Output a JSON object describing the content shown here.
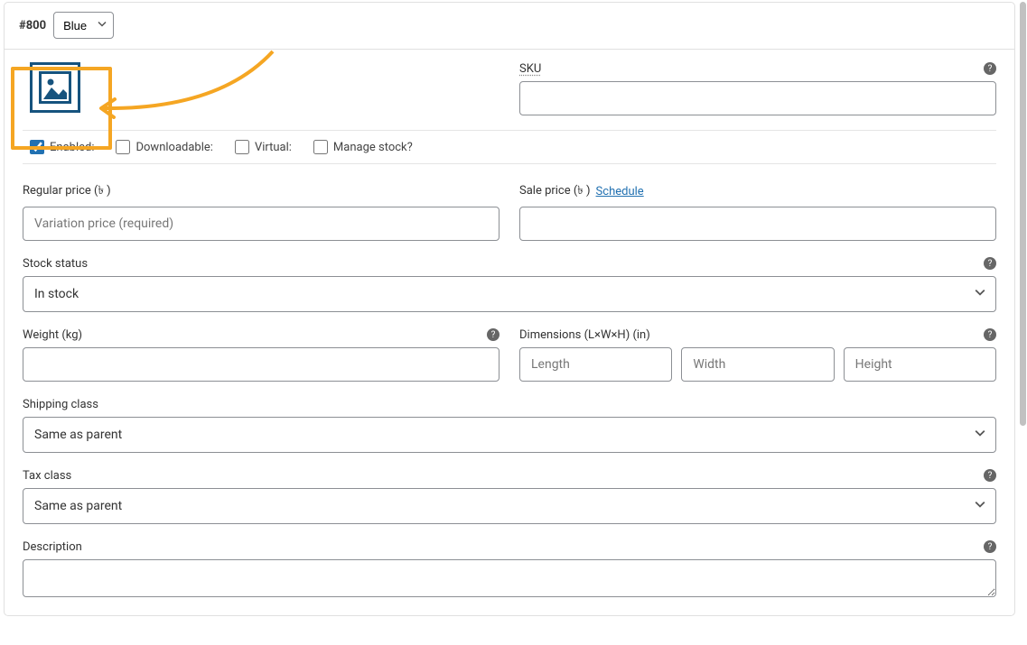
{
  "header": {
    "variation_number": "#800",
    "attribute_value": "Blue"
  },
  "sku": {
    "label": "SKU",
    "value": ""
  },
  "checkboxes": {
    "enabled": {
      "label": "Enabled:",
      "checked": true
    },
    "downloadable": {
      "label": "Downloadable:",
      "checked": false
    },
    "virtual": {
      "label": "Virtual:",
      "checked": false
    },
    "manage_stock": {
      "label": "Manage stock?",
      "checked": false
    }
  },
  "regular_price": {
    "label": "Regular price (৳ )",
    "placeholder": "Variation price (required)",
    "value": ""
  },
  "sale_price": {
    "label": "Sale price (৳ )",
    "schedule_link": "Schedule",
    "value": ""
  },
  "stock_status": {
    "label": "Stock status",
    "value": "In stock"
  },
  "weight": {
    "label": "Weight (kg)",
    "value": ""
  },
  "dimensions": {
    "label": "Dimensions (L×W×H) (in)",
    "length_placeholder": "Length",
    "width_placeholder": "Width",
    "height_placeholder": "Height"
  },
  "shipping_class": {
    "label": "Shipping class",
    "value": "Same as parent"
  },
  "tax_class": {
    "label": "Tax class",
    "value": "Same as parent"
  },
  "description": {
    "label": "Description",
    "value": ""
  },
  "help_icon": "?"
}
